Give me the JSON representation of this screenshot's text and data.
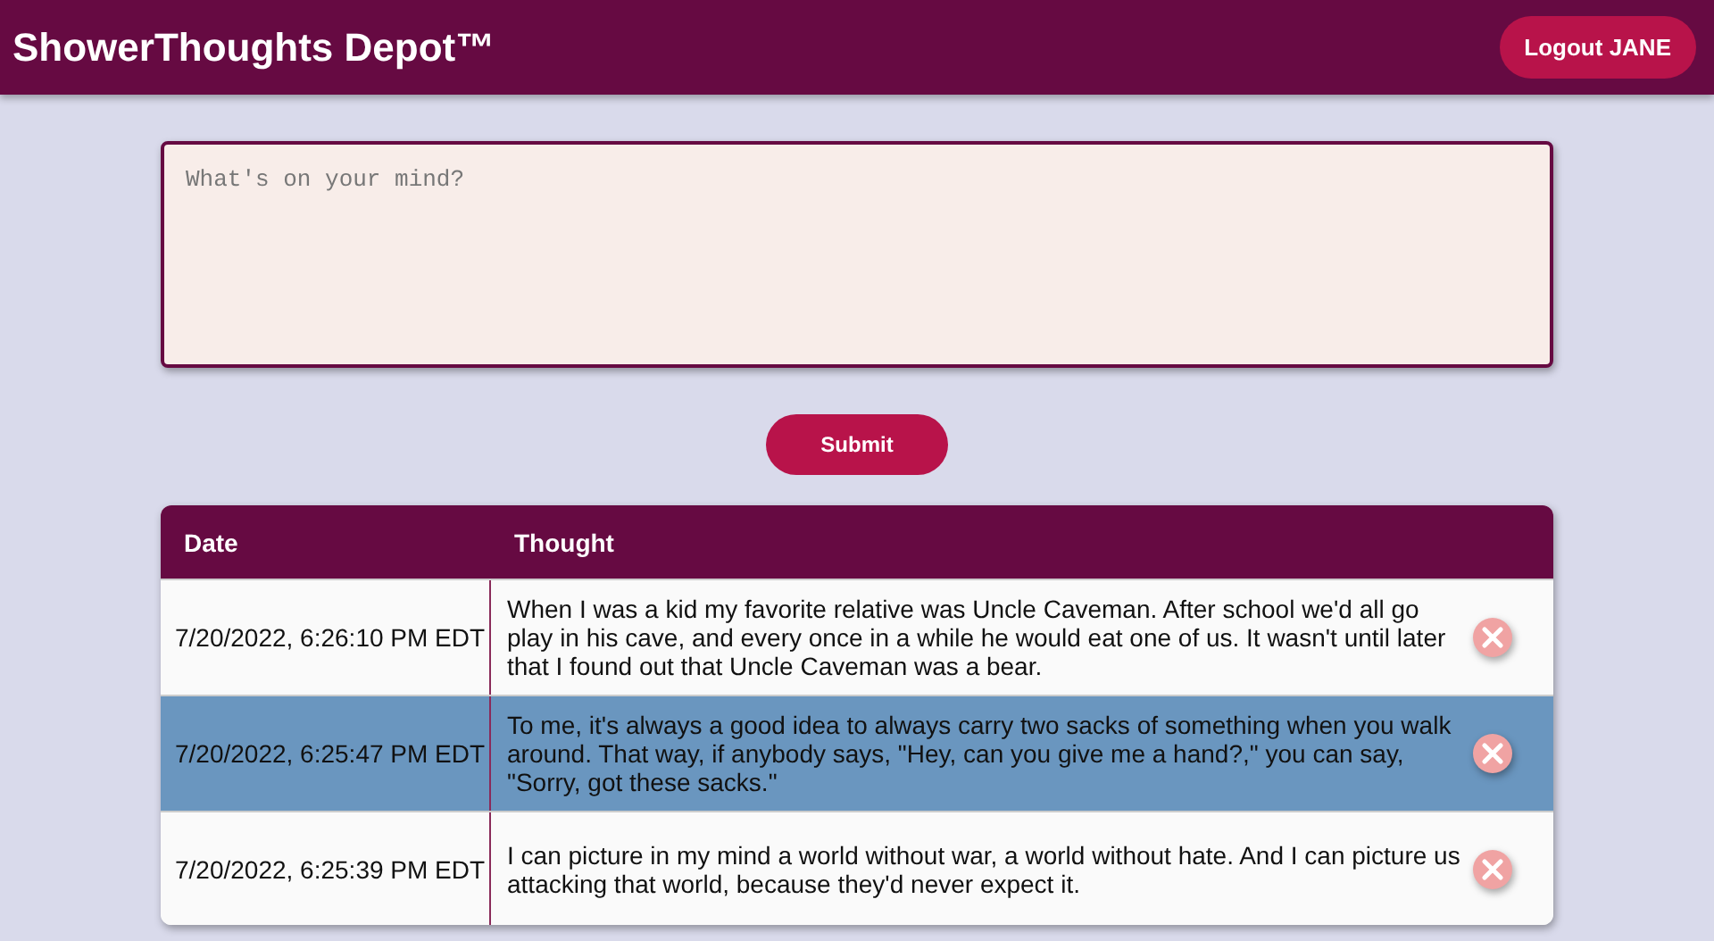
{
  "header": {
    "title": "ShowerThoughts Depot™",
    "logout_button": "Logout JANE"
  },
  "composer": {
    "placeholder": "What's on your mind?",
    "submit_button": "Submit"
  },
  "table": {
    "columns": [
      "Date",
      "Thought"
    ],
    "rows": [
      {
        "date": "7/20/2022, 6:26:10 PM EDT",
        "thought": "When I was a kid my favorite relative was Uncle Caveman. After school we'd all go play in his cave, and every once in a while he would eat one of us. It wasn't until later that I found out that Uncle Caveman was a bear.",
        "selected": false
      },
      {
        "date": "7/20/2022, 6:25:47 PM EDT",
        "thought": "To me, it's always a good idea to always carry two sacks of something when you walk around. That way, if anybody says, \"Hey, can you give me a hand?,\" you can say, \"Sorry, got these sacks.\"",
        "selected": true
      },
      {
        "date": "7/20/2022, 6:25:39 PM EDT",
        "thought": "I can picture in my mind a world without war, a world without hate. And I can picture us attacking that world, because they'd never expect it.",
        "selected": false
      }
    ]
  }
}
